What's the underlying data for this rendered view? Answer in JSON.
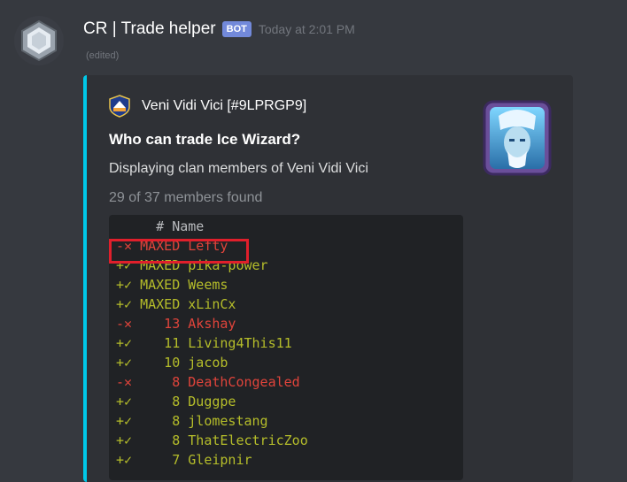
{
  "message": {
    "username": "CR | Trade helper",
    "bot_tag": "BOT",
    "timestamp": "Today at 2:01 PM",
    "edited": "(edited)"
  },
  "embed": {
    "accent_color": "#00c8e8",
    "author": "Veni Vidi Vici [#9LPRGP9]",
    "title": "Who can trade Ice Wizard?",
    "description": "Displaying clan members of Veni Vidi Vici",
    "count": "29 of 37 members found",
    "code_header": "     # Name",
    "rows": [
      {
        "status": "-✕",
        "level": "MAXED",
        "name": "Lefty",
        "ok": false
      },
      {
        "status": "+✓",
        "level": "MAXED",
        "name": "pika-power",
        "ok": true
      },
      {
        "status": "+✓",
        "level": "MAXED",
        "name": "Weems",
        "ok": true
      },
      {
        "status": "+✓",
        "level": "MAXED",
        "name": "xLinCx",
        "ok": true
      },
      {
        "status": "-✕",
        "level": "13",
        "name": "Akshay",
        "ok": false
      },
      {
        "status": "+✓",
        "level": "11",
        "name": "Living4This11",
        "ok": true
      },
      {
        "status": "+✓",
        "level": "10",
        "name": "jacob",
        "ok": true
      },
      {
        "status": "-✕",
        "level": "8",
        "name": "DeathCongealed",
        "ok": false
      },
      {
        "status": "+✓",
        "level": "8",
        "name": "Duggpe",
        "ok": true
      },
      {
        "status": "+✓",
        "level": "8",
        "name": "jlomestang",
        "ok": true
      },
      {
        "status": "+✓",
        "level": "8",
        "name": "ThatElectricZoo",
        "ok": true
      },
      {
        "status": "+✓",
        "level": "7",
        "name": "Gleipnir",
        "ok": true
      }
    ]
  },
  "icons": {
    "avatar": "crystal-token-icon",
    "author": "clan-badge-icon",
    "thumbnail": "ice-wizard-card"
  }
}
